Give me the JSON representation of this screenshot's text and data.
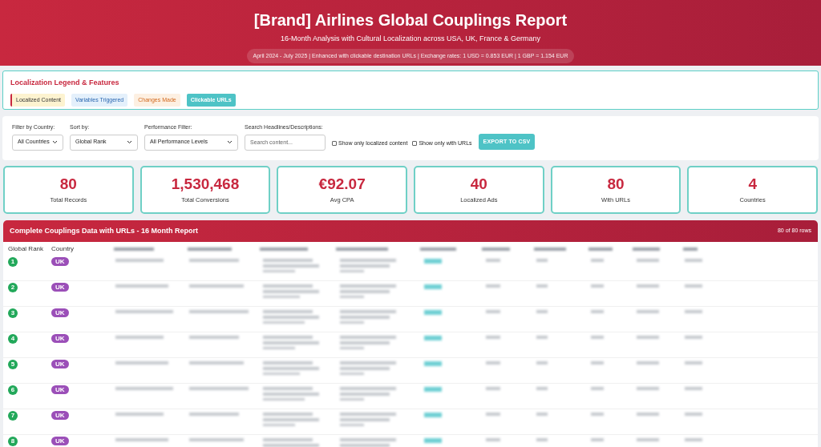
{
  "header": {
    "title": "[Brand] Airlines Global Couplings Report",
    "subtitle": "16-Month Analysis with Cultural Localization across USA, UK, France & Germany",
    "info": "April 2024 - July 2025 | Enhanced with clickable destination URLs | Exchange rates: 1 USD = 0.853 EUR | 1 GBP = 1.154 EUR"
  },
  "legend": {
    "title": "Localization Legend & Features",
    "items": [
      {
        "label": "Localized Content",
        "kind": "localized"
      },
      {
        "label": "Variables Triggered",
        "kind": "variables"
      },
      {
        "label": "Changes Made",
        "kind": "changes"
      },
      {
        "label": "Clickable URLs",
        "kind": "urls"
      }
    ]
  },
  "filters": {
    "selects": [
      {
        "label": "Filter by Country:",
        "value": "All Countries"
      },
      {
        "label": "Sort by:",
        "value": "Global Rank"
      },
      {
        "label": "Performance Filter:",
        "value": "All Performance Levels"
      }
    ],
    "search": {
      "label": "Search Headlines/Descriptions:",
      "placeholder": "Search content..."
    },
    "checkboxes": [
      {
        "label": "Show only localized content",
        "checked": false
      },
      {
        "label": "Show only with URLs",
        "checked": false
      }
    ],
    "export_button": "EXPORT TO CSV"
  },
  "stats": [
    {
      "value": "80",
      "label": "Total Records"
    },
    {
      "value": "1,530,468",
      "label": "Total Conversions"
    },
    {
      "value": "€92.07",
      "label": "Avg CPA"
    },
    {
      "value": "40",
      "label": "Localized Ads"
    },
    {
      "value": "80",
      "label": "With URLs"
    },
    {
      "value": "4",
      "label": "Countries"
    }
  ],
  "table": {
    "title": "Complete Couplings Data with URLs - 16 Month Report",
    "count": "80 of 80 rows",
    "columns": [
      "Global Rank",
      "Country"
    ],
    "rows": [
      {
        "rank": "1",
        "country": "UK"
      },
      {
        "rank": "2",
        "country": "UK"
      },
      {
        "rank": "3",
        "country": "UK"
      },
      {
        "rank": "4",
        "country": "UK"
      },
      {
        "rank": "5",
        "country": "UK"
      },
      {
        "rank": "6",
        "country": "UK"
      },
      {
        "rank": "7",
        "country": "UK"
      },
      {
        "rank": "8",
        "country": "UK"
      }
    ]
  }
}
